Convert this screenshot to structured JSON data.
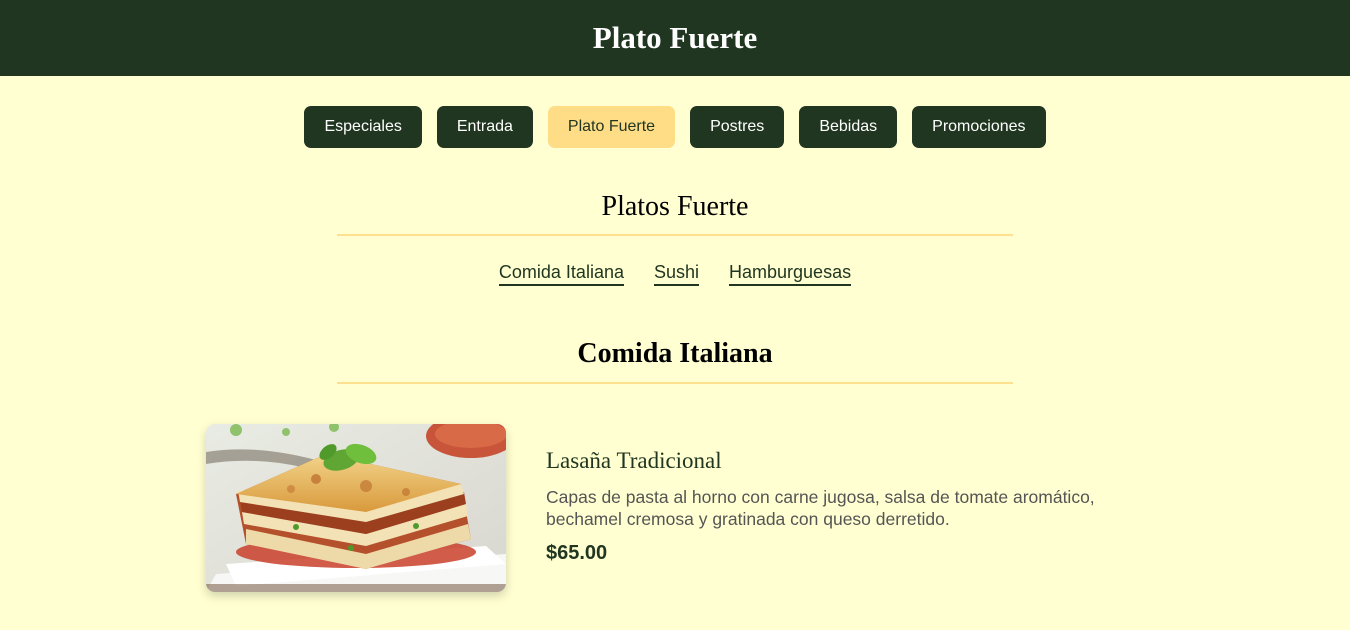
{
  "header": {
    "title": "Plato Fuerte"
  },
  "tabs": [
    {
      "label": "Especiales",
      "active": false
    },
    {
      "label": "Entrada",
      "active": false
    },
    {
      "label": "Plato Fuerte",
      "active": true
    },
    {
      "label": "Postres",
      "active": false
    },
    {
      "label": "Bebidas",
      "active": false
    },
    {
      "label": "Promociones",
      "active": false
    }
  ],
  "section": {
    "title": "Platos Fuerte"
  },
  "subnav": [
    "Comida Italiana",
    "Sushi",
    "Hamburguesas"
  ],
  "category": {
    "title": "Comida Italiana"
  },
  "dish": {
    "name": "Lasaña Tradicional",
    "description": "Capas de pasta al horno con carne jugosa, salsa de tomate aromático, bechamel cremosa y gratinada con queso derretido.",
    "price": "$65.00",
    "image": "lasagna-photo"
  },
  "colors": {
    "primary": "#213621",
    "accent": "#ffdd86",
    "background": "#ffffd1",
    "rule": "#ffe08f"
  }
}
